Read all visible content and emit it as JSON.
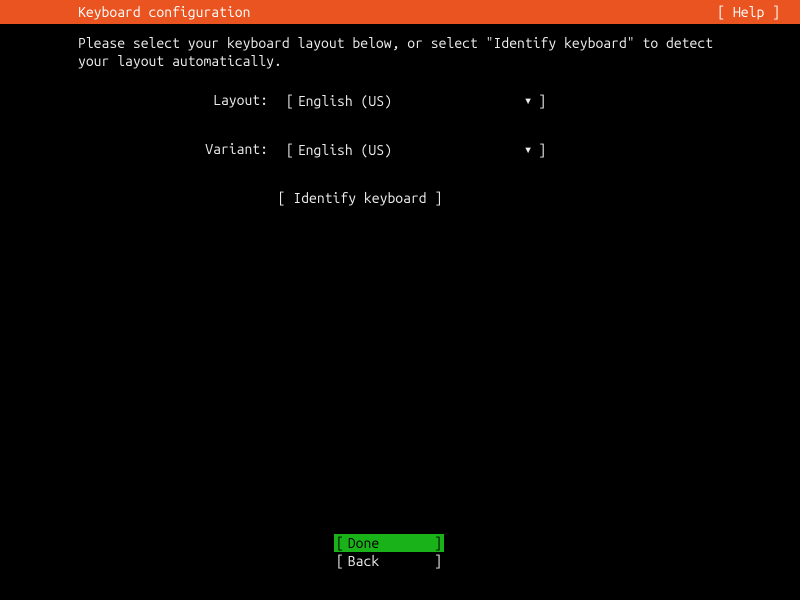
{
  "header": {
    "title": "Keyboard configuration",
    "help": "[ Help ]"
  },
  "instruction": "Please select your keyboard layout below, or select \"Identify keyboard\" to detect your layout automatically.",
  "fields": {
    "layout": {
      "label": "Layout:",
      "value": "English (US)"
    },
    "variant": {
      "label": "Variant:",
      "value": "English (US)"
    }
  },
  "identify": {
    "label": "Identify keyboard"
  },
  "footer": {
    "done": "Done",
    "back": "Back"
  }
}
